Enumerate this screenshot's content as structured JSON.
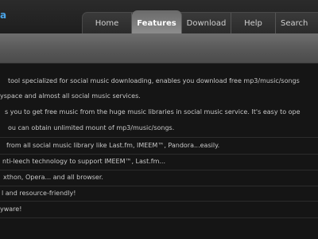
{
  "header": {
    "logo_fragment": "a"
  },
  "nav": {
    "tabs": [
      {
        "label": "Home"
      },
      {
        "label": "Features",
        "active": true
      },
      {
        "label": "Download"
      },
      {
        "label": "Help"
      },
      {
        "label": "Search"
      }
    ]
  },
  "content": {
    "paragraphs": [
      "tool specialized for social music downloading, enables you download free mp3/music/songs",
      "yspace and almost all social music services.",
      "s you to get free music from the huge music libraries in social music service. It's easy to ope",
      "ou can obtain unlimited mount of mp3/music/songs."
    ],
    "bullets": [
      "from all social music library like Last.fm, IMEEM™, Pandora...easily.",
      "nti-leech technology to support IMEEM™, Last.fm...",
      "xthon, Opera... and all browser.",
      "l and resource-friendly!",
      "yware!"
    ]
  },
  "colors": {
    "background": "#151515",
    "accent": "#4aa3e6",
    "active_tab": "#8e8e8e",
    "text": "#c8c8c8"
  }
}
